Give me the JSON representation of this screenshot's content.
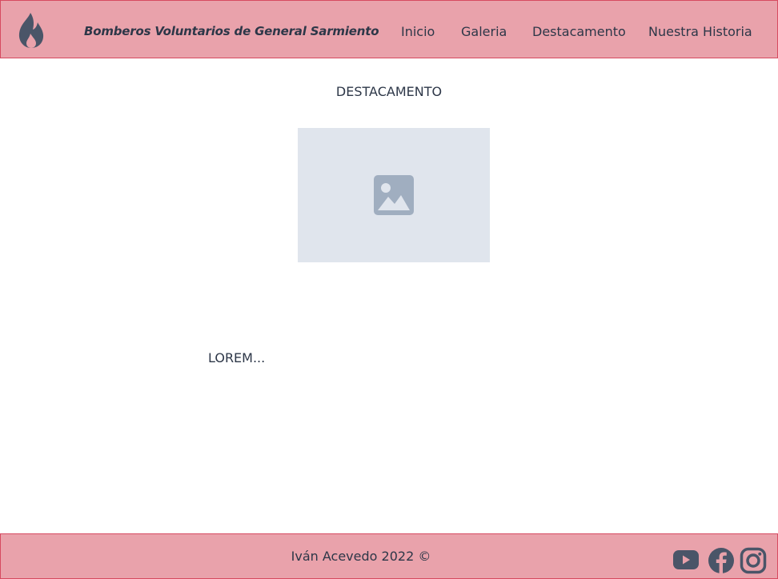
{
  "header": {
    "brand": "Bomberos Voluntarios de General Sarmiento",
    "logo_icon": "flame-icon",
    "nav": [
      {
        "label": "Inicio"
      },
      {
        "label": "Galeria"
      },
      {
        "label": "Destacamento"
      },
      {
        "label": "Nuestra Historia"
      }
    ]
  },
  "main": {
    "heading": "DESTACAMENTO",
    "image_icon": "image-placeholder-icon",
    "body": "LOREM..."
  },
  "footer": {
    "copyright": "Iván Acevedo 2022 ©",
    "social": [
      {
        "icon": "youtube-icon"
      },
      {
        "icon": "facebook-icon"
      },
      {
        "icon": "instagram-icon"
      }
    ]
  },
  "colors": {
    "header_bg": "#e9a2ab",
    "header_border": "#d64a60",
    "text": "#2d3748",
    "icon": "#4a5568",
    "placeholder_bg": "#e0e5ed",
    "placeholder_icon": "#a0aec0"
  }
}
